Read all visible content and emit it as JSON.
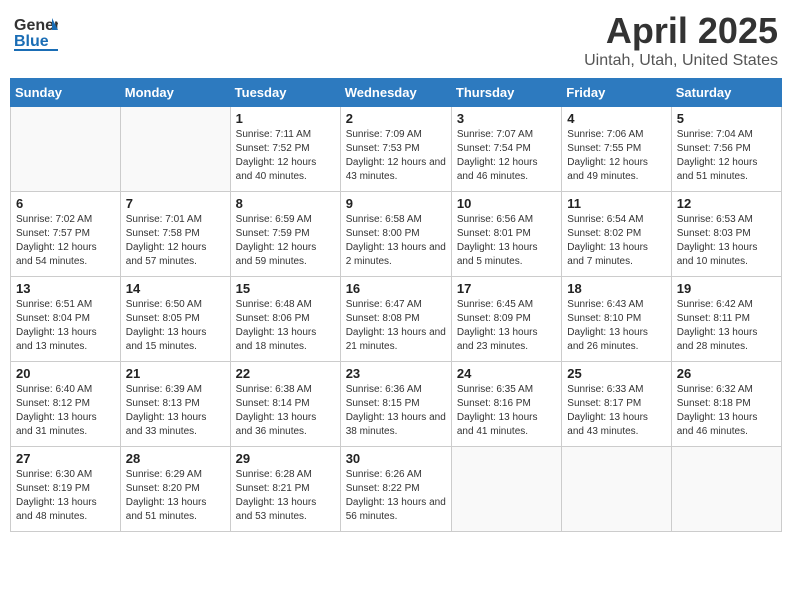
{
  "header": {
    "logo_text_general": "General",
    "logo_text_blue": "Blue",
    "title": "April 2025",
    "location": "Uintah, Utah, United States"
  },
  "weekdays": [
    "Sunday",
    "Monday",
    "Tuesday",
    "Wednesday",
    "Thursday",
    "Friday",
    "Saturday"
  ],
  "weeks": [
    [
      {
        "day": "",
        "info": ""
      },
      {
        "day": "",
        "info": ""
      },
      {
        "day": "1",
        "info": "Sunrise: 7:11 AM\nSunset: 7:52 PM\nDaylight: 12 hours and 40 minutes."
      },
      {
        "day": "2",
        "info": "Sunrise: 7:09 AM\nSunset: 7:53 PM\nDaylight: 12 hours and 43 minutes."
      },
      {
        "day": "3",
        "info": "Sunrise: 7:07 AM\nSunset: 7:54 PM\nDaylight: 12 hours and 46 minutes."
      },
      {
        "day": "4",
        "info": "Sunrise: 7:06 AM\nSunset: 7:55 PM\nDaylight: 12 hours and 49 minutes."
      },
      {
        "day": "5",
        "info": "Sunrise: 7:04 AM\nSunset: 7:56 PM\nDaylight: 12 hours and 51 minutes."
      }
    ],
    [
      {
        "day": "6",
        "info": "Sunrise: 7:02 AM\nSunset: 7:57 PM\nDaylight: 12 hours and 54 minutes."
      },
      {
        "day": "7",
        "info": "Sunrise: 7:01 AM\nSunset: 7:58 PM\nDaylight: 12 hours and 57 minutes."
      },
      {
        "day": "8",
        "info": "Sunrise: 6:59 AM\nSunset: 7:59 PM\nDaylight: 12 hours and 59 minutes."
      },
      {
        "day": "9",
        "info": "Sunrise: 6:58 AM\nSunset: 8:00 PM\nDaylight: 13 hours and 2 minutes."
      },
      {
        "day": "10",
        "info": "Sunrise: 6:56 AM\nSunset: 8:01 PM\nDaylight: 13 hours and 5 minutes."
      },
      {
        "day": "11",
        "info": "Sunrise: 6:54 AM\nSunset: 8:02 PM\nDaylight: 13 hours and 7 minutes."
      },
      {
        "day": "12",
        "info": "Sunrise: 6:53 AM\nSunset: 8:03 PM\nDaylight: 13 hours and 10 minutes."
      }
    ],
    [
      {
        "day": "13",
        "info": "Sunrise: 6:51 AM\nSunset: 8:04 PM\nDaylight: 13 hours and 13 minutes."
      },
      {
        "day": "14",
        "info": "Sunrise: 6:50 AM\nSunset: 8:05 PM\nDaylight: 13 hours and 15 minutes."
      },
      {
        "day": "15",
        "info": "Sunrise: 6:48 AM\nSunset: 8:06 PM\nDaylight: 13 hours and 18 minutes."
      },
      {
        "day": "16",
        "info": "Sunrise: 6:47 AM\nSunset: 8:08 PM\nDaylight: 13 hours and 21 minutes."
      },
      {
        "day": "17",
        "info": "Sunrise: 6:45 AM\nSunset: 8:09 PM\nDaylight: 13 hours and 23 minutes."
      },
      {
        "day": "18",
        "info": "Sunrise: 6:43 AM\nSunset: 8:10 PM\nDaylight: 13 hours and 26 minutes."
      },
      {
        "day": "19",
        "info": "Sunrise: 6:42 AM\nSunset: 8:11 PM\nDaylight: 13 hours and 28 minutes."
      }
    ],
    [
      {
        "day": "20",
        "info": "Sunrise: 6:40 AM\nSunset: 8:12 PM\nDaylight: 13 hours and 31 minutes."
      },
      {
        "day": "21",
        "info": "Sunrise: 6:39 AM\nSunset: 8:13 PM\nDaylight: 13 hours and 33 minutes."
      },
      {
        "day": "22",
        "info": "Sunrise: 6:38 AM\nSunset: 8:14 PM\nDaylight: 13 hours and 36 minutes."
      },
      {
        "day": "23",
        "info": "Sunrise: 6:36 AM\nSunset: 8:15 PM\nDaylight: 13 hours and 38 minutes."
      },
      {
        "day": "24",
        "info": "Sunrise: 6:35 AM\nSunset: 8:16 PM\nDaylight: 13 hours and 41 minutes."
      },
      {
        "day": "25",
        "info": "Sunrise: 6:33 AM\nSunset: 8:17 PM\nDaylight: 13 hours and 43 minutes."
      },
      {
        "day": "26",
        "info": "Sunrise: 6:32 AM\nSunset: 8:18 PM\nDaylight: 13 hours and 46 minutes."
      }
    ],
    [
      {
        "day": "27",
        "info": "Sunrise: 6:30 AM\nSunset: 8:19 PM\nDaylight: 13 hours and 48 minutes."
      },
      {
        "day": "28",
        "info": "Sunrise: 6:29 AM\nSunset: 8:20 PM\nDaylight: 13 hours and 51 minutes."
      },
      {
        "day": "29",
        "info": "Sunrise: 6:28 AM\nSunset: 8:21 PM\nDaylight: 13 hours and 53 minutes."
      },
      {
        "day": "30",
        "info": "Sunrise: 6:26 AM\nSunset: 8:22 PM\nDaylight: 13 hours and 56 minutes."
      },
      {
        "day": "",
        "info": ""
      },
      {
        "day": "",
        "info": ""
      },
      {
        "day": "",
        "info": ""
      }
    ]
  ]
}
